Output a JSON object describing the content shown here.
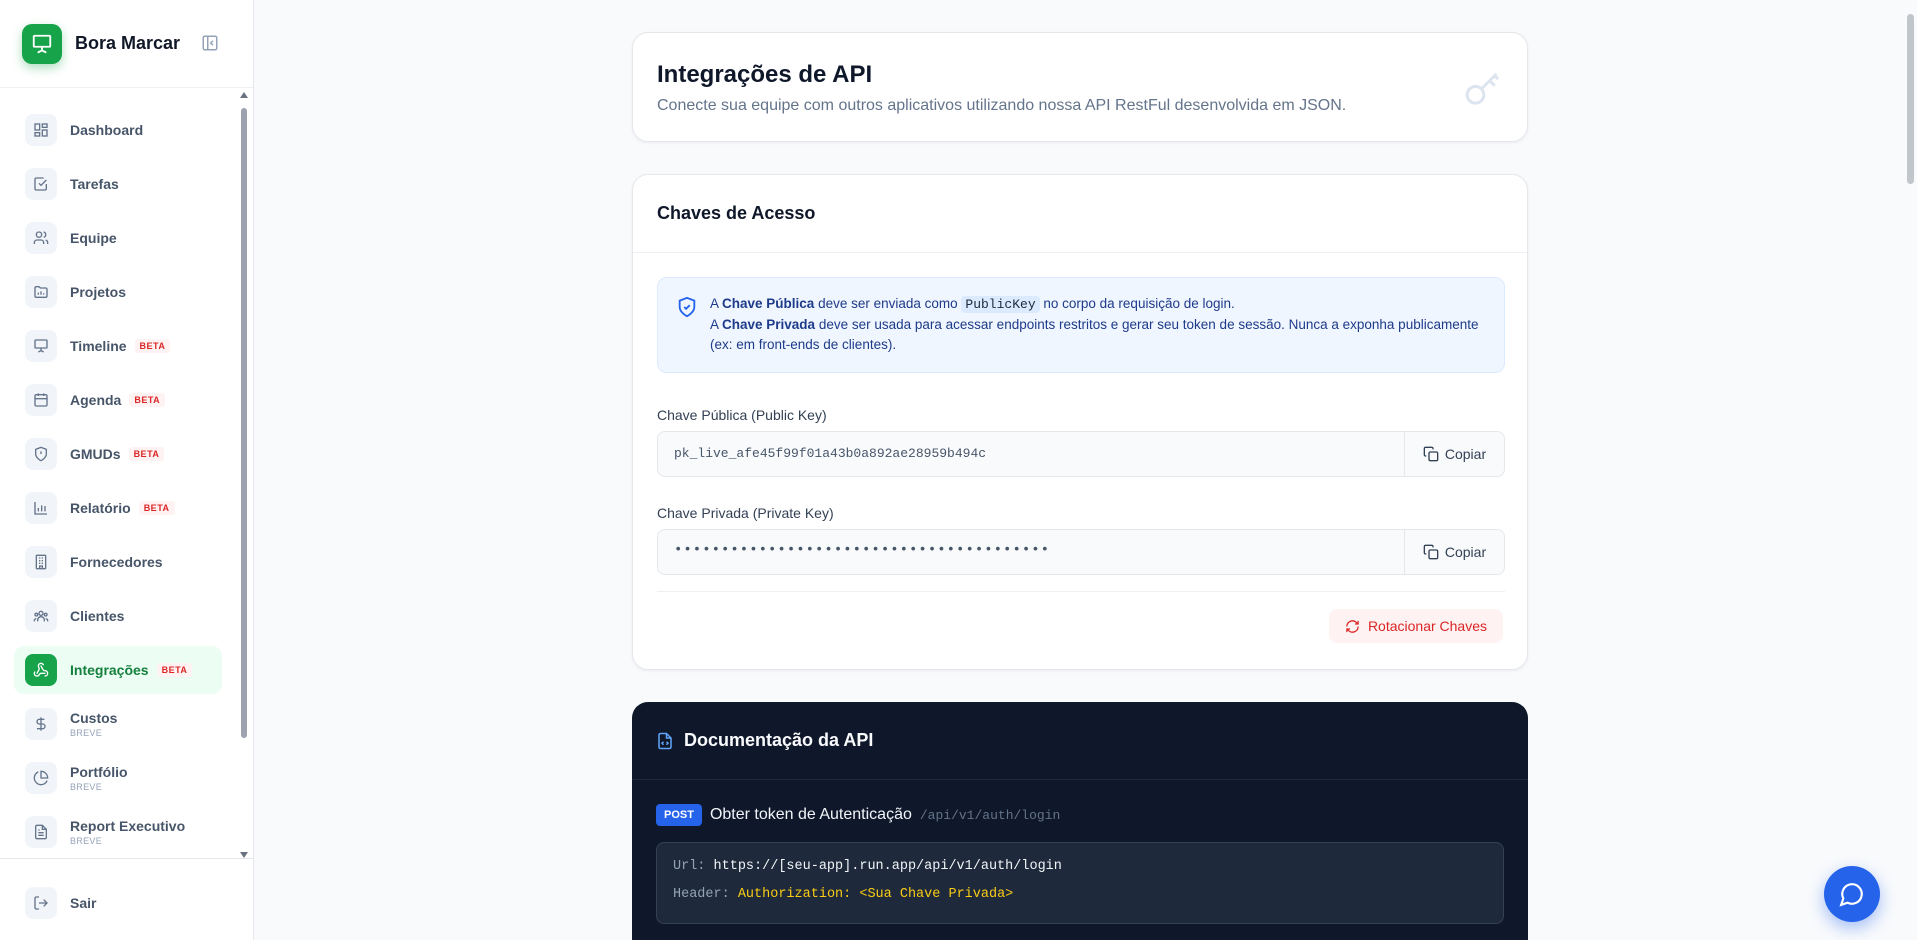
{
  "app": {
    "name": "Bora Marcar"
  },
  "sidebar": {
    "items": [
      {
        "label": "Dashboard",
        "icon": "dashboard-grid-icon"
      },
      {
        "label": "Tarefas",
        "icon": "checkbox-icon"
      },
      {
        "label": "Equipe",
        "icon": "users-icon"
      },
      {
        "label": "Projetos",
        "icon": "folder-chart-icon"
      },
      {
        "label": "Timeline",
        "icon": "presentation-icon",
        "badge": "BETA"
      },
      {
        "label": "Agenda",
        "icon": "calendar-icon",
        "badge": "BETA"
      },
      {
        "label": "GMUDs",
        "icon": "shield-icon",
        "badge": "BETA"
      },
      {
        "label": "Relatório",
        "icon": "bar-chart-icon",
        "badge": "BETA"
      },
      {
        "label": "Fornecedores",
        "icon": "building-icon"
      },
      {
        "label": "Clientes",
        "icon": "handshake-icon"
      },
      {
        "label": "Integrações",
        "icon": "webhook-icon",
        "badge": "BETA",
        "active": true
      },
      {
        "label": "Custos",
        "icon": "dollar-icon",
        "sub": "BREVE"
      },
      {
        "label": "Portfólio",
        "icon": "pie-chart-icon",
        "sub": "BREVE"
      },
      {
        "label": "Report Executivo",
        "icon": "file-text-icon",
        "sub": "BREVE"
      }
    ],
    "logout_label": "Sair"
  },
  "header": {
    "title": "Integrações de API",
    "subtitle": "Conecte sua equipe com outros aplicativos utilizando nossa API RestFul desenvolvida em JSON."
  },
  "keys": {
    "title": "Chaves de Acesso",
    "info": {
      "line1_a": "A ",
      "line1_b": "Chave Pública",
      "line1_c": " deve ser enviada como ",
      "line1_code": "PublicKey",
      "line1_d": " no corpo da requisição de login.",
      "line2_a": "A ",
      "line2_b": "Chave Privada",
      "line2_c": " deve ser usada para acessar endpoints restritos e gerar seu token de sessão. Nunca a exponha publicamente (ex: em front-ends de clientes)."
    },
    "public_label": "Chave Pública (Public Key)",
    "public_value": "pk_live_afe45f99f01a43b0a892ae28959b494c",
    "private_label": "Chave Privada (Private Key)",
    "private_value": "••••••••••••••••••••••••••••••••••••••••",
    "copy_label": "Copiar",
    "rotate_label": "Rotacionar Chaves"
  },
  "docs": {
    "title": "Documentação da API",
    "endpoint": {
      "method": "POST",
      "title": "Obter token de Autenticação",
      "path": "/api/v1/auth/login"
    },
    "code": {
      "url_key": "Url:",
      "url_value": "https://[seu-app].run.app/api/v1/auth/login",
      "header_key": "Header:",
      "header_value": "Authorization: <Sua Chave Privada>"
    }
  },
  "colors": {
    "brand": "#16a34a",
    "accent": "#2563eb",
    "danger": "#dc2626"
  }
}
